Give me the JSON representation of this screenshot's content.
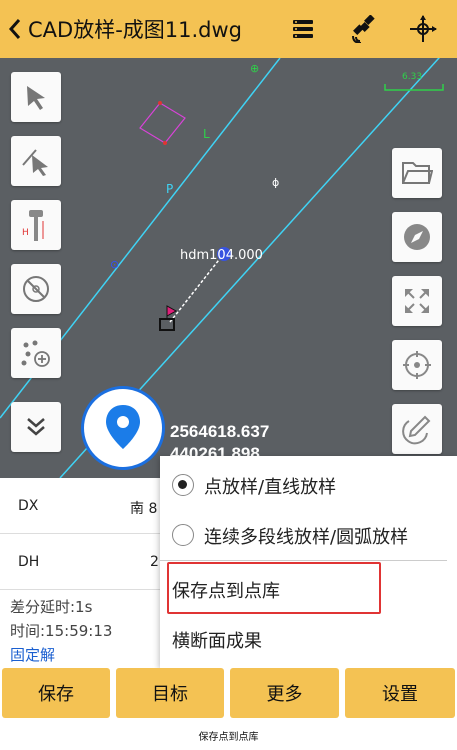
{
  "header": {
    "title": "CAD放样-成图11.dwg"
  },
  "map": {
    "hdm_label": "hdm104.000",
    "scale_label": "6.33",
    "coord_north": "2564618.637",
    "coord_east": "440261.898"
  },
  "info": {
    "rows": [
      {
        "key": "DX",
        "value": "南 8"
      },
      {
        "key": "DH",
        "value": "2"
      }
    ],
    "delay": "差分延时:1s",
    "time": "时间:15:59:13",
    "fix": "固定解"
  },
  "menu": {
    "items": [
      {
        "label": "点放样/直线放样",
        "checked": true
      },
      {
        "label": "连续多段线放样/圆弧放样",
        "checked": false
      },
      {
        "label": "保存点到点库"
      },
      {
        "label": "横断面成果"
      }
    ]
  },
  "bottom_bar": {
    "save": "保存",
    "target": "目标",
    "more": "更多",
    "settings": "设置"
  },
  "caption": "保存点到点库",
  "colors": {
    "accent": "#f4c253",
    "map_bg": "#5b5f63",
    "line": "#3fd3f5",
    "highlight": "#e03434",
    "link": "#1a5fd0"
  }
}
